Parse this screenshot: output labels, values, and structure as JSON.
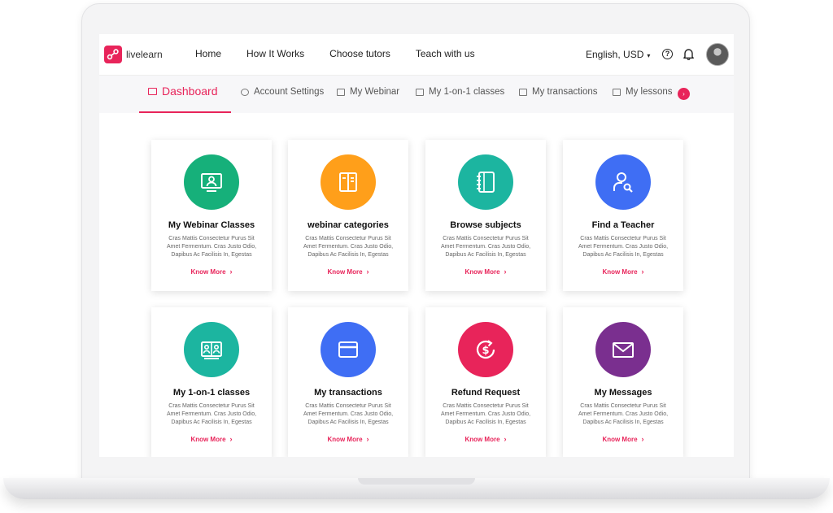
{
  "brand": {
    "logo_text": "livelearn",
    "accent": "#e8245a"
  },
  "nav": {
    "items": [
      "Home",
      "How It Works",
      "Choose tutors",
      "Teach with us"
    ]
  },
  "header": {
    "language_currency": "English, USD",
    "caret": "▾",
    "help_glyph": "?"
  },
  "tabs": [
    {
      "label": "Dashboard",
      "active": true
    },
    {
      "label": "Account Settings"
    },
    {
      "label": "My Webinar"
    },
    {
      "label": "My 1-on-1 classes"
    },
    {
      "label": "My transactions"
    },
    {
      "label": "My lessons"
    }
  ],
  "tabs_badge": "›",
  "cards": [
    {
      "title": "My Webinar Classes",
      "icon": "monitor-user-icon",
      "color": "#16b07a",
      "desc": "Cras Mattis Consectetur Purus Sit Amet Fermentum. Cras Justo Odio, Dapibus Ac Facilisis In, Egestas",
      "more": "Know More"
    },
    {
      "title": "webinar categories",
      "icon": "book-open-icon",
      "color": "#ff9f1a",
      "desc": "Cras Mattis Consectetur Purus Sit Amet Fermentum. Cras Justo Odio, Dapibus Ac Facilisis In, Egestas",
      "more": "Know More"
    },
    {
      "title": "Browse subjects",
      "icon": "notebook-icon",
      "color": "#1cb5a0",
      "desc": "Cras Mattis Consectetur Purus Sit Amet Fermentum. Cras Justo Odio, Dapibus Ac Facilisis In, Egestas",
      "more": "Know More"
    },
    {
      "title": "Find a Teacher",
      "icon": "user-search-icon",
      "color": "#3f6ef4",
      "desc": "Cras Mattis Consectetur Purus Sit Amet Fermentum. Cras Justo Odio, Dapibus Ac Facilisis In, Egestas",
      "more": "Know More"
    },
    {
      "title": "My 1-on-1 classes",
      "icon": "one-on-one-icon",
      "color": "#1cb5a0",
      "desc": "Cras Mattis Consectetur Purus Sit Amet Fermentum. Cras Justo Odio, Dapibus Ac Facilisis In, Egestas",
      "more": "Know More"
    },
    {
      "title": "My transactions",
      "icon": "card-icon",
      "color": "#3f6ef4",
      "desc": "Cras Mattis Consectetur Purus Sit Amet Fermentum. Cras Justo Odio, Dapibus Ac Facilisis In, Egestas",
      "more": "Know More"
    },
    {
      "title": "Refund Request",
      "icon": "refund-dollar-icon",
      "color": "#e8245a",
      "desc": "Cras Mattis Consectetur Purus Sit Amet Fermentum. Cras Justo Odio, Dapibus Ac Facilisis In, Egestas",
      "more": "Know More"
    },
    {
      "title": "My Messages",
      "icon": "envelope-icon",
      "color": "#7a2f8f",
      "desc": "Cras Mattis Consectetur Purus Sit Amet Fermentum. Cras Justo Odio, Dapibus Ac Facilisis In, Egestas",
      "more": "Know More"
    }
  ]
}
